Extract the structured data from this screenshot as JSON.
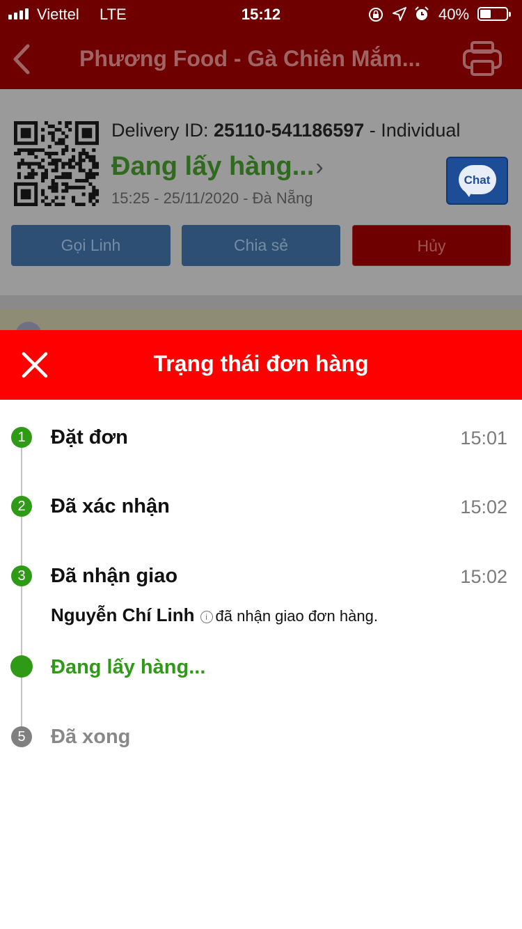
{
  "status_bar": {
    "carrier": "Viettel",
    "network": "LTE",
    "time": "15:12",
    "battery": "40%",
    "battery_level": 0.4,
    "icons": [
      "orientation-lock-icon",
      "location-arrow-icon",
      "alarm-icon"
    ]
  },
  "navbar": {
    "title": "Phương Food - Gà Chiên Mắm...",
    "back_icon": "chevron-left-icon",
    "print_icon": "printer-icon"
  },
  "order": {
    "delivery_id_label": "Delivery ID: ",
    "delivery_id": "25110-541186597",
    "delivery_type": " - Individual",
    "status": "Đang lấy hàng...",
    "datetime_location": "15:25 - 25/11/2020 - Đà Nẵng",
    "chat_label": "Chat"
  },
  "actions": {
    "call": "Gọi Linh",
    "share": "Chia sẻ",
    "cancel": "Hủy"
  },
  "sheet": {
    "title": "Trạng thái đơn hàng",
    "steps": [
      {
        "number": "1",
        "label": "Đặt đơn",
        "time": "15:01",
        "state": "done"
      },
      {
        "number": "2",
        "label": "Đã xác nhận",
        "time": "15:02",
        "state": "done"
      },
      {
        "number": "3",
        "label": "Đã nhận giao",
        "time": "15:02",
        "state": "done"
      },
      {
        "number": "",
        "label": "Đang lấy hàng...",
        "time": "",
        "state": "active"
      },
      {
        "number": "5",
        "label": "Đã xong",
        "time": "",
        "state": "pending"
      }
    ],
    "driver_note": {
      "driver_name": "Nguyễn Chí Linh",
      "info_icon": "i",
      "text": "đã nhận giao đơn hàng."
    }
  },
  "colors": {
    "header_dimmed": "#6e0000",
    "sheet_header": "#ff0000",
    "done_green": "#2e9a15",
    "pending_gray": "#808080"
  }
}
